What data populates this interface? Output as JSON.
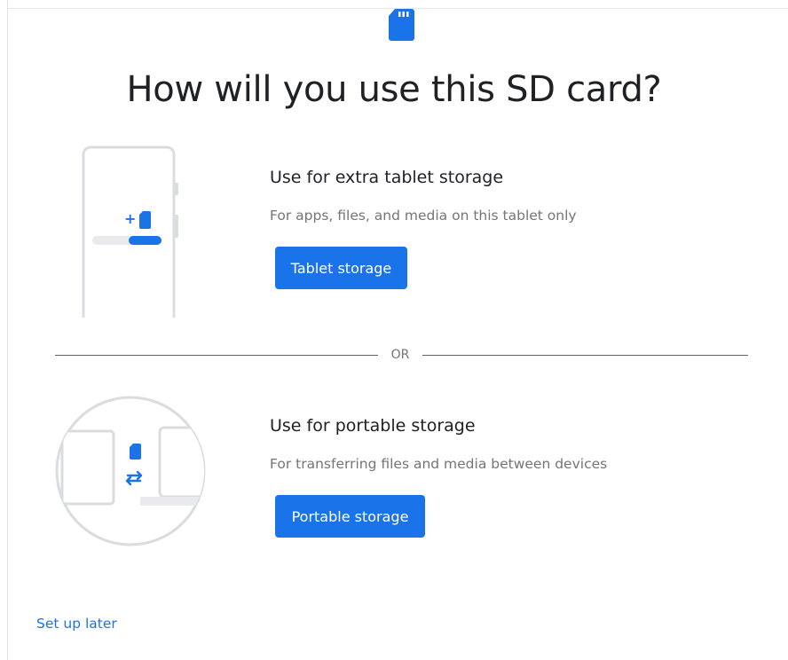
{
  "title": "How will you use this SD card?",
  "options": [
    {
      "title": "Use for extra tablet storage",
      "description": "For apps, files, and media on this tablet only",
      "button_label": "Tablet storage"
    },
    {
      "title": "Use for portable storage",
      "description": "For transferring files and media between devices",
      "button_label": "Portable storage"
    }
  ],
  "divider_label": "OR",
  "footer": {
    "setup_later_label": "Set up later"
  },
  "icons": {
    "header": "sd-card-icon",
    "tablet_illustration": "tablet-storage-illustration",
    "portable_illustration": "portable-storage-illustration"
  },
  "colors": {
    "accent": "#1a73e8",
    "text_primary": "#202124",
    "text_secondary": "#757575"
  }
}
